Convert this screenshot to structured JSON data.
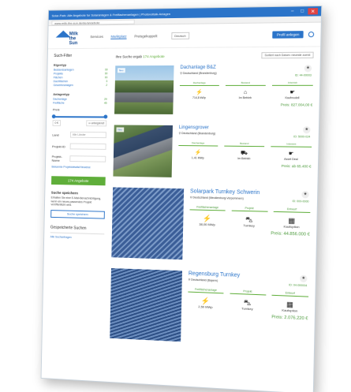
{
  "window": {
    "title": "Solar-Park: Alle Angebote fur Solaranlagen & Freiflachenanlagen | Photovoltaik-Anlagen",
    "url": "www.milk-the-sun.de/de/angebote"
  },
  "header": {
    "logo_line1": "Milk",
    "logo_line2": "the Sun",
    "nav": [
      "Services",
      "Marktplatz",
      "Preisgekuppelt"
    ],
    "language": "Deutsch",
    "cta": "Profil anlegen"
  },
  "sidebar": {
    "title": "Such-Filter",
    "group_label": "Eigentyp",
    "types": [
      {
        "label": "Bestandsanlagen",
        "count": "18"
      },
      {
        "label": "Projekte",
        "count": "30"
      },
      {
        "label": "Flächen",
        "count": "16"
      },
      {
        "label": "Dachflächen",
        "count": "3"
      },
      {
        "label": "Gewerbeanlagen",
        "count": "2"
      }
    ],
    "group2_label": "Anlagentyp",
    "types2": [
      {
        "label": "Dachanlage",
        "count": "29"
      },
      {
        "label": "Freifläche",
        "count": "45"
      }
    ],
    "price_label": "Preis",
    "price_min": "0 €",
    "price_max": "∞ unbegrenzt",
    "land_label": "Land",
    "land_value": "Alle Länder",
    "projekt_label": "Projekt-ID",
    "projekt_name_label": "Projekt-Name",
    "link": "Bekannte Projektdetails/Hinweise",
    "search_button": "174 Angebote",
    "save_heading": "Suche speichern",
    "save_text": "Erhalten Sie eine E-Mail-Benachrichtigung, wenn ein neues passendes Projekt veröffentlicht wird.",
    "save_button": "Suche speichern",
    "saved_heading": "Gespeicherte Suchen",
    "saved_link": "Alle Suchanfragen"
  },
  "results": {
    "count_prefix": "Ihre Suche ergab",
    "count_value": "174 Angebote",
    "sort": "Sortiert nach Datum: neueste zuerst"
  },
  "cards": [
    {
      "badge": "Neu",
      "title": "Dachanlage B&Z",
      "location": "Deutschland (Brandenburg)",
      "ref": "ID: 44-00003",
      "tags": [
        "Dachanlage",
        "Bestand",
        "Inbetrieb"
      ],
      "stats": [
        {
          "icon": "lightning-icon",
          "value": "714,8 kWp"
        },
        {
          "icon": "roof-icon",
          "value": "Im Betrieb"
        },
        {
          "icon": "handshake-icon",
          "value": "Kaufmodell"
        }
      ],
      "price": "Preis: 827.004,00 €"
    },
    {
      "badge": "Neu",
      "title": "Lingensgrover",
      "location": "Deutschland (Brandenburg)",
      "ref": "ID: 5000-024",
      "tags": [
        "Dachanlage",
        "Bestand",
        "Inbetrieb"
      ],
      "stats": [
        {
          "icon": "lightning-icon",
          "value": "1,41 MWp"
        },
        {
          "icon": "truck-icon",
          "value": "Im Betrieb"
        },
        {
          "icon": "handshake-icon",
          "value": "Asset Deal"
        }
      ],
      "price": "Preis: ab 65.400 €"
    },
    {
      "badge": "",
      "title": "Solarpark Turnkey Schwerin",
      "location": "Deutschland (Mecklenburg-Vorpommern)",
      "ref": "ID: 000-0000",
      "tags": [
        "Freiflächenanlage",
        "Projekt",
        "Entwurf"
      ],
      "stats": [
        {
          "icon": "lightning-icon",
          "value": "38,00 MWp"
        },
        {
          "icon": "car-icon",
          "value": "Turnkey"
        },
        {
          "icon": "factory-icon",
          "value": "Kaufoption"
        }
      ],
      "price": "Preis: 44.856.000 €"
    },
    {
      "badge": "",
      "title": "Regensburg Turnkey",
      "location": "Deutschland (Bayern)",
      "ref": "ID: 04-000004",
      "tags": [
        "Freiflächenanlage",
        "Projekt",
        "Entwurf"
      ],
      "stats": [
        {
          "icon": "lightning-icon",
          "value": "2,50 MWp"
        },
        {
          "icon": "car-icon",
          "value": "Turnkey"
        },
        {
          "icon": "factory-icon",
          "value": "Kaufoption"
        }
      ],
      "price": "Preis: 2.076.220 €"
    }
  ]
}
